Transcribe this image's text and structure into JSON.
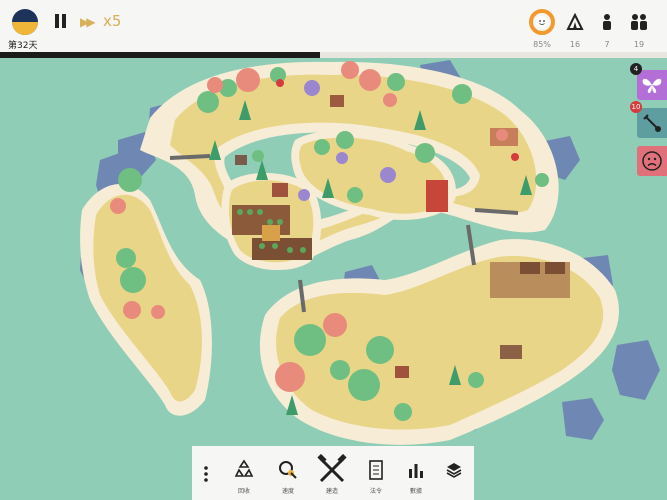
{
  "hud": {
    "day_label": "第32天",
    "speed_label": "x5",
    "day_progress": 0.48,
    "stats": {
      "happiness": "85%",
      "shelters": "16",
      "workers": "7",
      "population": "19"
    }
  },
  "notifications": {
    "butterfly_count": "4",
    "tool_count": "10"
  },
  "toolbar": {
    "recycle_label": "回收",
    "speed_label": "速度",
    "build_label": "建造",
    "law_label": "法令",
    "data_label": "數據"
  },
  "colors": {
    "water": "#8fcdb6",
    "sand": "#f7ecd6",
    "grass": "#e9d587",
    "rock": "#6f88b3",
    "accent_gold": "#d8b94a",
    "happiness_orange": "#f29a2e",
    "butterfly_purple": "#b36ed8",
    "tool_teal": "#5f9ea0",
    "sad_red": "#e0707a"
  }
}
